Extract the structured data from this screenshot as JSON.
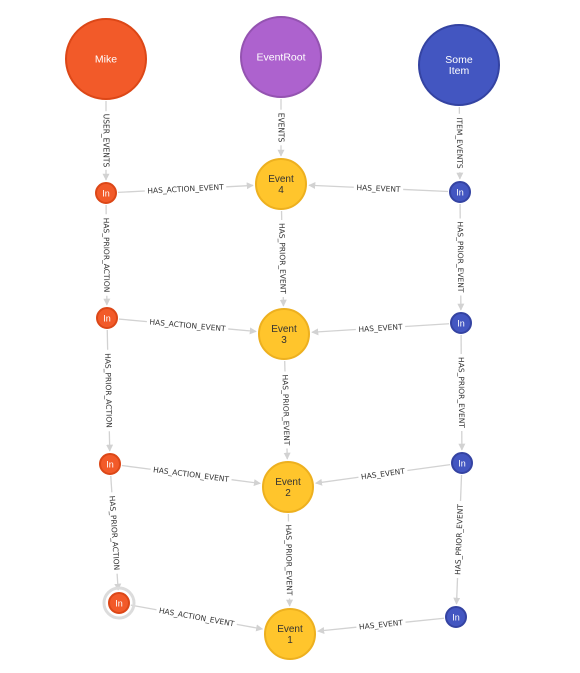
{
  "colors": {
    "user": "#f25a29",
    "user_border": "#dc4717",
    "root": "#ad62ce",
    "root_border": "#9453b1",
    "item": "#4356c1",
    "item_border": "#3443a2",
    "event": "#ffc52c",
    "event_border": "#edb01f",
    "edge": "#d2d2d2",
    "label_light": "#ffffff",
    "label_dark": "#333333"
  },
  "graph": {
    "nodes": [
      {
        "id": "mike",
        "label": [
          "Mike"
        ],
        "kind": "user"
      },
      {
        "id": "eventroot",
        "label": [
          "EventRoot"
        ],
        "kind": "root"
      },
      {
        "id": "someitem",
        "label": [
          "Some",
          "Item"
        ],
        "kind": "item"
      },
      {
        "id": "e4",
        "label": [
          "Event",
          "4"
        ],
        "kind": "event"
      },
      {
        "id": "e3",
        "label": [
          "Event",
          "3"
        ],
        "kind": "event"
      },
      {
        "id": "e2",
        "label": [
          "Event",
          "2"
        ],
        "kind": "event"
      },
      {
        "id": "e1",
        "label": [
          "Event",
          "1"
        ],
        "kind": "event"
      },
      {
        "id": "u4",
        "label": [
          "In"
        ],
        "kind": "user"
      },
      {
        "id": "u3",
        "label": [
          "In"
        ],
        "kind": "user"
      },
      {
        "id": "u2",
        "label": [
          "In"
        ],
        "kind": "user"
      },
      {
        "id": "u1",
        "label": [
          "In"
        ],
        "kind": "user",
        "selected": true
      },
      {
        "id": "i4",
        "label": [
          "In"
        ],
        "kind": "item"
      },
      {
        "id": "i3",
        "label": [
          "In"
        ],
        "kind": "item"
      },
      {
        "id": "i2",
        "label": [
          "In"
        ],
        "kind": "item"
      },
      {
        "id": "i1",
        "label": [
          "In"
        ],
        "kind": "item"
      }
    ],
    "edges": [
      {
        "from": "mike",
        "to": "u4",
        "label": "USER_EVENTS"
      },
      {
        "from": "eventroot",
        "to": "e4",
        "label": "EVENTS"
      },
      {
        "from": "someitem",
        "to": "i4",
        "label": "ITEM_EVENTS"
      },
      {
        "from": "u4",
        "to": "e4",
        "label": "HAS_ACTION_EVENT"
      },
      {
        "from": "i4",
        "to": "e4",
        "label": "HAS_EVENT"
      },
      {
        "from": "u4",
        "to": "u3",
        "label": "HAS_PRIOR_ACTION"
      },
      {
        "from": "e4",
        "to": "e3",
        "label": "HAS_PRIOR_EVENT"
      },
      {
        "from": "i4",
        "to": "i3",
        "label": "HAS_PRIOR_EVENT"
      },
      {
        "from": "u3",
        "to": "e3",
        "label": "HAS_ACTION_EVENT"
      },
      {
        "from": "i3",
        "to": "e3",
        "label": "HAS_EVENT"
      },
      {
        "from": "u3",
        "to": "u2",
        "label": "HAS_PRIOR_ACTION"
      },
      {
        "from": "e3",
        "to": "e2",
        "label": "HAS_PRIOR_EVENT"
      },
      {
        "from": "i3",
        "to": "i2",
        "label": "HAS_PRIOR_EVENT"
      },
      {
        "from": "u2",
        "to": "e2",
        "label": "HAS_ACTION_EVENT"
      },
      {
        "from": "i2",
        "to": "e2",
        "label": "HAS_EVENT"
      },
      {
        "from": "u2",
        "to": "u1",
        "label": "HAS_PRIOR_ACTION"
      },
      {
        "from": "e2",
        "to": "e1",
        "label": "HAS_PRIOR_EVENT"
      },
      {
        "from": "i2",
        "to": "i1",
        "label": "HAS_PRIOR_EVENT"
      },
      {
        "from": "u1",
        "to": "e1",
        "label": "HAS_ACTION_EVENT"
      },
      {
        "from": "i1",
        "to": "e1",
        "label": "HAS_EVENT"
      }
    ]
  }
}
